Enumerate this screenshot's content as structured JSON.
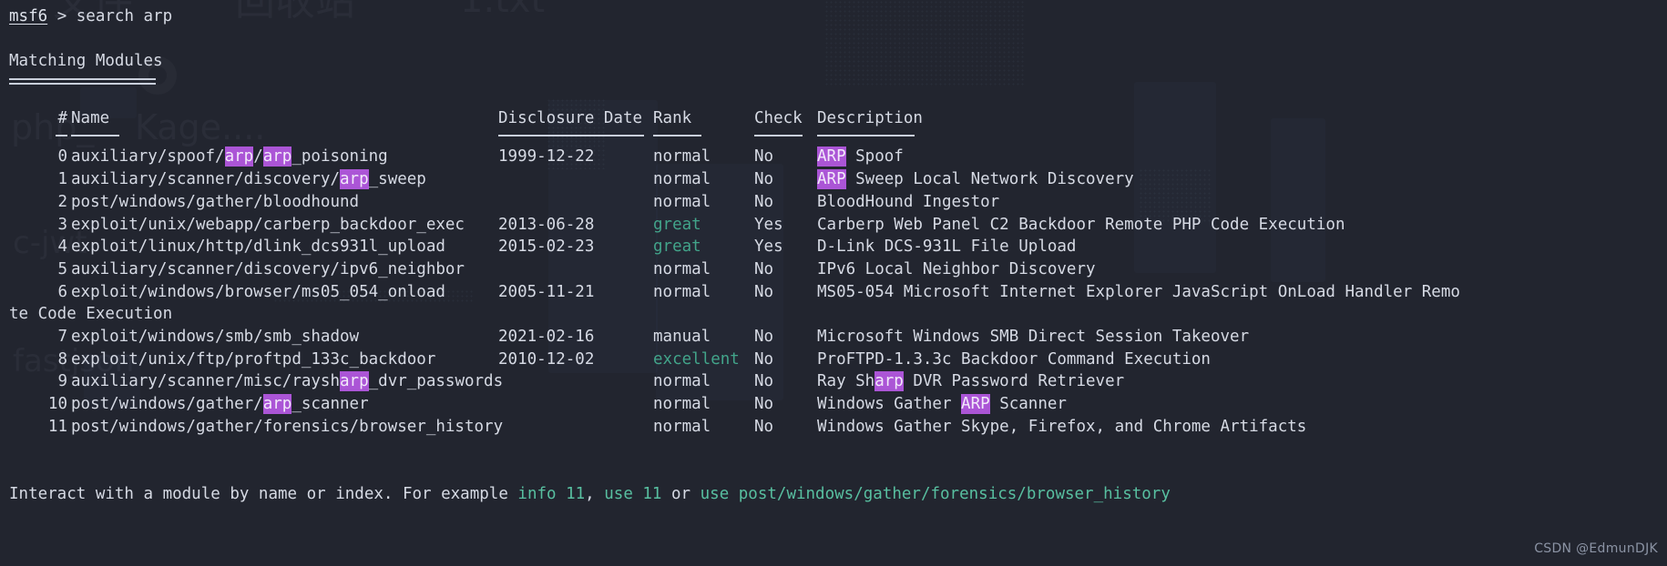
{
  "terminal": {
    "prompt_user": "msf6",
    "prompt_sep": " > ",
    "command": "search arp",
    "section_title": "Matching Modules",
    "background_hint": [
      "文件",
      "回收站",
      "1.txt",
      "php_",
      "Kage....",
      "c-jwt",
      "fastjson"
    ]
  },
  "table": {
    "headers": {
      "index": "#",
      "name": "Name",
      "disclosure_date": "Disclosure Date",
      "rank": "Rank",
      "check": "Check",
      "description": "Description"
    },
    "rows": [
      {
        "index": "0",
        "name_pre": "auxiliary/spoof/",
        "name_hl1": "arp",
        "name_mid": "/",
        "name_hl2": "arp",
        "name_post": "_poisoning",
        "date": "1999-12-22",
        "rank": "normal",
        "rank_color": "default",
        "check": "No",
        "desc_hl": "ARP",
        "desc_post": " Spoof"
      },
      {
        "index": "1",
        "name_pre": "auxiliary/scanner/discovery/",
        "name_hl1": "arp",
        "name_mid": "",
        "name_hl2": "",
        "name_post": "_sweep",
        "date": "",
        "rank": "normal",
        "rank_color": "default",
        "check": "No",
        "desc_hl": "ARP",
        "desc_post": " Sweep Local Network Discovery"
      },
      {
        "index": "2",
        "name_pre": "post/windows/gather/bloodhound",
        "name_hl1": "",
        "name_mid": "",
        "name_hl2": "",
        "name_post": "",
        "date": "",
        "rank": "normal",
        "rank_color": "default",
        "check": "No",
        "desc_hl": "",
        "desc_post": "BloodHound Ingestor"
      },
      {
        "index": "3",
        "name_pre": "exploit/unix/webapp/carberp_backdoor_exec",
        "name_hl1": "",
        "name_mid": "",
        "name_hl2": "",
        "name_post": "",
        "date": "2013-06-28",
        "rank": "great",
        "rank_color": "green",
        "check": "Yes",
        "desc_hl": "",
        "desc_post": "Carberp Web Panel C2 Backdoor Remote PHP Code Execution"
      },
      {
        "index": "4",
        "name_pre": "exploit/linux/http/dlink_dcs931l_upload",
        "name_hl1": "",
        "name_mid": "",
        "name_hl2": "",
        "name_post": "",
        "date": "2015-02-23",
        "rank": "great",
        "rank_color": "green",
        "check": "Yes",
        "desc_hl": "",
        "desc_post": "D-Link DCS-931L File Upload"
      },
      {
        "index": "5",
        "name_pre": "auxiliary/scanner/discovery/ipv6_neighbor",
        "name_hl1": "",
        "name_mid": "",
        "name_hl2": "",
        "name_post": "",
        "date": "",
        "rank": "normal",
        "rank_color": "default",
        "check": "No",
        "desc_hl": "",
        "desc_post": "IPv6 Local Neighbor Discovery"
      },
      {
        "index": "6",
        "name_pre": "exploit/windows/browser/ms05_054_onload",
        "name_hl1": "",
        "name_mid": "",
        "name_hl2": "",
        "name_post": "",
        "date": "2005-11-21",
        "rank": "normal",
        "rank_color": "default",
        "check": "No",
        "desc_hl": "",
        "desc_post": "MS05-054 Microsoft Internet Explorer JavaScript OnLoad Handler Remo"
      }
    ],
    "wrapped_line": "te Code Execution",
    "rows2": [
      {
        "index": "7",
        "name_pre": "exploit/windows/smb/smb_shadow",
        "name_hl1": "",
        "name_mid": "",
        "name_hl2": "",
        "name_post": "",
        "date": "2021-02-16",
        "rank": "manual",
        "rank_color": "default",
        "check": "No",
        "desc_hl": "",
        "desc_post": "Microsoft Windows SMB Direct Session Takeover"
      },
      {
        "index": "8",
        "name_pre": "exploit/unix/ftp/proftpd_133c_backdoor",
        "name_hl1": "",
        "name_mid": "",
        "name_hl2": "",
        "name_post": "",
        "date": "2010-12-02",
        "rank": "excellent",
        "rank_color": "green",
        "check": "No",
        "desc_hl": "",
        "desc_post": "ProFTPD-1.3.3c Backdoor Command Execution"
      },
      {
        "index": "9",
        "name_pre": "auxiliary/scanner/misc/raysh",
        "name_hl1": "arp",
        "name_mid": "",
        "name_hl2": "",
        "name_post": "_dvr_passwords",
        "date": "",
        "rank": "normal",
        "rank_color": "default",
        "check": "No",
        "desc_hl": "",
        "desc_post_a": "Ray Sh",
        "desc_hl2": "arp",
        "desc_post_b": " DVR Password Retriever"
      },
      {
        "index": "10",
        "name_pre": "post/windows/gather/",
        "name_hl1": "arp",
        "name_mid": "",
        "name_hl2": "",
        "name_post": "_scanner",
        "date": "",
        "rank": "normal",
        "rank_color": "default",
        "check": "No",
        "desc_post_a": "Windows Gather ",
        "desc_hl2": "ARP",
        "desc_post_b": " Scanner"
      },
      {
        "index": "11",
        "name_pre": "post/windows/gather/forensics/browser_history",
        "name_hl1": "",
        "name_mid": "",
        "name_hl2": "",
        "name_post": "",
        "date": "",
        "rank": "normal",
        "rank_color": "default",
        "check": "No",
        "desc_hl": "",
        "desc_post": "Windows Gather Skype, Firefox, and Chrome Artifacts"
      }
    ]
  },
  "footer": {
    "part1": "Interact with a module by name or index. For example ",
    "cmd1": "info 11",
    "part2": ", ",
    "cmd2": "use 11",
    "part3": " or ",
    "cmd3": "use post/windows/gather/forensics/browser_history"
  },
  "watermark": "CSDN @EdmunDJK",
  "colors": {
    "background": "#22252f",
    "text": "#d6dae4",
    "highlight_bg": "#ab55d6",
    "rank_good": "#42a48a",
    "command_link": "#58bfa0"
  }
}
